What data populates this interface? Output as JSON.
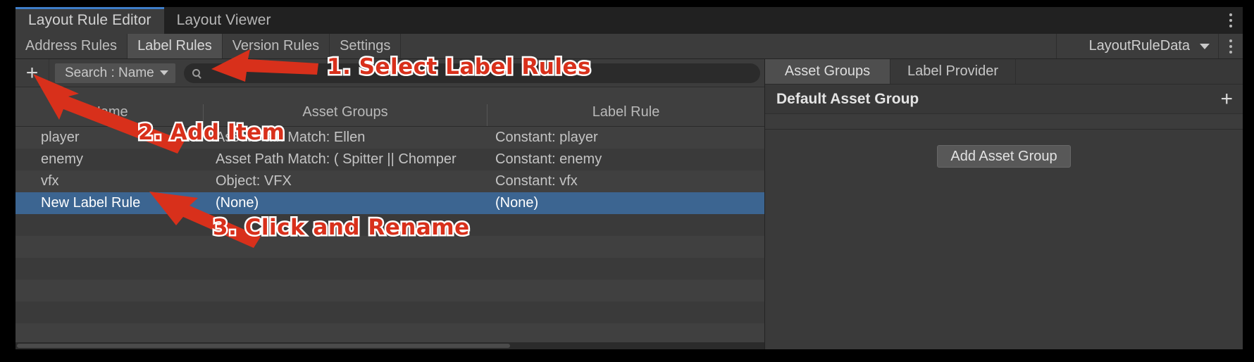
{
  "window": {
    "main_tabs": [
      {
        "label": "Layout Rule Editor",
        "active": true
      },
      {
        "label": "Layout Viewer",
        "active": false
      }
    ],
    "kebab_icon": "more-vertical-icon"
  },
  "subtabs": {
    "items": [
      {
        "label": "Address Rules",
        "active": false
      },
      {
        "label": "Label Rules",
        "active": true
      },
      {
        "label": "Version Rules",
        "active": false
      },
      {
        "label": "Settings",
        "active": false
      }
    ],
    "asset_selector": {
      "value": "LayoutRuleData",
      "caret_icon": "chevron-down-icon",
      "kebab_icon": "more-vertical-icon"
    }
  },
  "toolbar": {
    "add_label": "+",
    "search_kind_label": "Search : Name",
    "search_kind_caret": "chevron-down-icon",
    "search_icon": "search-icon",
    "search_value": "",
    "search_placeholder": ""
  },
  "table": {
    "columns": [
      "Name",
      "Asset Groups",
      "Label Rule"
    ],
    "rows": [
      {
        "name": "player",
        "asset_groups": "Asset Path Match: Ellen",
        "label_rule": "Constant: player",
        "selected": false
      },
      {
        "name": "enemy",
        "asset_groups": "Asset Path Match: ( Spitter || Chomper",
        "label_rule": "Constant: enemy",
        "selected": false
      },
      {
        "name": "vfx",
        "asset_groups": "Object: VFX",
        "label_rule": "Constant: vfx",
        "selected": false
      },
      {
        "name": "New Label Rule",
        "asset_groups": "(None)",
        "label_rule": "(None)",
        "selected": true
      }
    ],
    "empty_rows": 6,
    "scrollbar": "horizontal-scrollbar"
  },
  "right_panel": {
    "tabs": [
      {
        "label": "Asset Groups",
        "active": true
      },
      {
        "label": "Label Provider",
        "active": false
      }
    ],
    "group_title": "Default Asset Group",
    "group_add_icon": "+",
    "add_button_label": "Add Asset Group"
  },
  "annotations": [
    {
      "id": "step-1",
      "text": "1. Select Label Rules"
    },
    {
      "id": "step-2",
      "text": "2. Add Item"
    },
    {
      "id": "step-3",
      "text": "3. Click and Rename"
    }
  ],
  "colors": {
    "accent_blue": "#3e7ec9",
    "selection_blue": "#3c6591",
    "annotation_red": "#d8301b",
    "panel_bg": "#383838"
  }
}
